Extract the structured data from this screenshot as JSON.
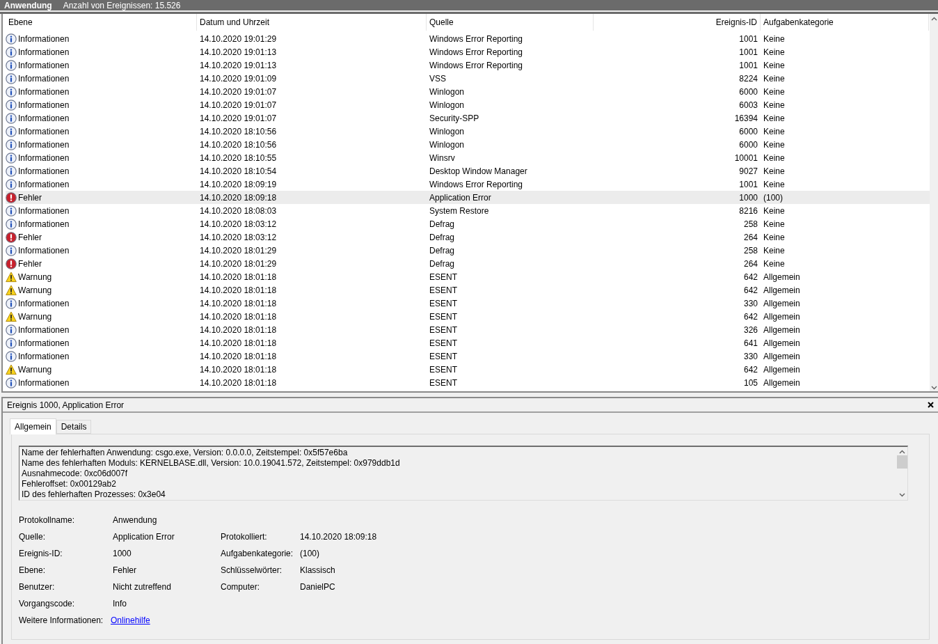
{
  "log": {
    "name": "Anwendung",
    "count": "Anzahl von Ereignissen: 15.526"
  },
  "columns": [
    {
      "label": "Ebene"
    },
    {
      "label": "Datum und Uhrzeit"
    },
    {
      "label": "Quelle"
    },
    {
      "label": "Ereignis-ID"
    },
    {
      "label": "Aufgabenkategorie"
    }
  ],
  "rows": [
    {
      "kind": "info",
      "level": "Informationen",
      "time": "14.10.2020 19:01:29",
      "source": "Windows Error Reporting",
      "id": "1001",
      "category": "Keine",
      "selected": false
    },
    {
      "kind": "info",
      "level": "Informationen",
      "time": "14.10.2020 19:01:13",
      "source": "Windows Error Reporting",
      "id": "1001",
      "category": "Keine",
      "selected": false
    },
    {
      "kind": "info",
      "level": "Informationen",
      "time": "14.10.2020 19:01:13",
      "source": "Windows Error Reporting",
      "id": "1001",
      "category": "Keine",
      "selected": false
    },
    {
      "kind": "info",
      "level": "Informationen",
      "time": "14.10.2020 19:01:09",
      "source": "VSS",
      "id": "8224",
      "category": "Keine",
      "selected": false
    },
    {
      "kind": "info",
      "level": "Informationen",
      "time": "14.10.2020 19:01:07",
      "source": "Winlogon",
      "id": "6000",
      "category": "Keine",
      "selected": false
    },
    {
      "kind": "info",
      "level": "Informationen",
      "time": "14.10.2020 19:01:07",
      "source": "Winlogon",
      "id": "6003",
      "category": "Keine",
      "selected": false
    },
    {
      "kind": "info",
      "level": "Informationen",
      "time": "14.10.2020 19:01:07",
      "source": "Security-SPP",
      "id": "16394",
      "category": "Keine",
      "selected": false
    },
    {
      "kind": "info",
      "level": "Informationen",
      "time": "14.10.2020 18:10:56",
      "source": "Winlogon",
      "id": "6000",
      "category": "Keine",
      "selected": false
    },
    {
      "kind": "info",
      "level": "Informationen",
      "time": "14.10.2020 18:10:56",
      "source": "Winlogon",
      "id": "6000",
      "category": "Keine",
      "selected": false
    },
    {
      "kind": "info",
      "level": "Informationen",
      "time": "14.10.2020 18:10:55",
      "source": "Winsrv",
      "id": "10001",
      "category": "Keine",
      "selected": false
    },
    {
      "kind": "info",
      "level": "Informationen",
      "time": "14.10.2020 18:10:54",
      "source": "Desktop Window Manager",
      "id": "9027",
      "category": "Keine",
      "selected": false
    },
    {
      "kind": "info",
      "level": "Informationen",
      "time": "14.10.2020 18:09:19",
      "source": "Windows Error Reporting",
      "id": "1001",
      "category": "Keine",
      "selected": false
    },
    {
      "kind": "error",
      "level": "Fehler",
      "time": "14.10.2020 18:09:18",
      "source": "Application Error",
      "id": "1000",
      "category": "(100)",
      "selected": true
    },
    {
      "kind": "info",
      "level": "Informationen",
      "time": "14.10.2020 18:08:03",
      "source": "System Restore",
      "id": "8216",
      "category": "Keine",
      "selected": false
    },
    {
      "kind": "info",
      "level": "Informationen",
      "time": "14.10.2020 18:03:12",
      "source": "Defrag",
      "id": "258",
      "category": "Keine",
      "selected": false
    },
    {
      "kind": "error",
      "level": "Fehler",
      "time": "14.10.2020 18:03:12",
      "source": "Defrag",
      "id": "264",
      "category": "Keine",
      "selected": false
    },
    {
      "kind": "info",
      "level": "Informationen",
      "time": "14.10.2020 18:01:29",
      "source": "Defrag",
      "id": "258",
      "category": "Keine",
      "selected": false
    },
    {
      "kind": "error",
      "level": "Fehler",
      "time": "14.10.2020 18:01:29",
      "source": "Defrag",
      "id": "264",
      "category": "Keine",
      "selected": false
    },
    {
      "kind": "warning",
      "level": "Warnung",
      "time": "14.10.2020 18:01:18",
      "source": "ESENT",
      "id": "642",
      "category": "Allgemein",
      "selected": false
    },
    {
      "kind": "warning",
      "level": "Warnung",
      "time": "14.10.2020 18:01:18",
      "source": "ESENT",
      "id": "642",
      "category": "Allgemein",
      "selected": false
    },
    {
      "kind": "info",
      "level": "Informationen",
      "time": "14.10.2020 18:01:18",
      "source": "ESENT",
      "id": "330",
      "category": "Allgemein",
      "selected": false
    },
    {
      "kind": "warning",
      "level": "Warnung",
      "time": "14.10.2020 18:01:18",
      "source": "ESENT",
      "id": "642",
      "category": "Allgemein",
      "selected": false
    },
    {
      "kind": "info",
      "level": "Informationen",
      "time": "14.10.2020 18:01:18",
      "source": "ESENT",
      "id": "326",
      "category": "Allgemein",
      "selected": false
    },
    {
      "kind": "info",
      "level": "Informationen",
      "time": "14.10.2020 18:01:18",
      "source": "ESENT",
      "id": "641",
      "category": "Allgemein",
      "selected": false
    },
    {
      "kind": "info",
      "level": "Informationen",
      "time": "14.10.2020 18:01:18",
      "source": "ESENT",
      "id": "330",
      "category": "Allgemein",
      "selected": false
    },
    {
      "kind": "warning",
      "level": "Warnung",
      "time": "14.10.2020 18:01:18",
      "source": "ESENT",
      "id": "642",
      "category": "Allgemein",
      "selected": false
    },
    {
      "kind": "info",
      "level": "Informationen",
      "time": "14.10.2020 18:01:18",
      "source": "ESENT",
      "id": "105",
      "category": "Allgemein",
      "selected": false
    }
  ],
  "detail": {
    "title": "Ereignis 1000, Application Error",
    "tabs": [
      {
        "label": "Allgemein",
        "selected": true
      },
      {
        "label": "Details",
        "selected": false
      }
    ],
    "message": [
      "Name der fehlerhaften Anwendung: csgo.exe, Version: 0.0.0.0, Zeitstempel: 0x5f57e6ba",
      "Name des fehlerhaften Moduls: KERNELBASE.dll, Version: 10.0.19041.572, Zeitstempel: 0x979ddb1d",
      "Ausnahmecode: 0xc06d007f",
      "Fehleroffset: 0x00129ab2",
      "ID des fehlerhaften Prozesses: 0x3e04"
    ],
    "properties": [
      {
        "items": [
          {
            "label": "Protokollname:",
            "value": "Anwendung",
            "kind": "text"
          }
        ]
      },
      {
        "items": [
          {
            "label": "Quelle:",
            "value": "Application Error",
            "kind": "text"
          },
          {
            "label": "Protokolliert:",
            "value": "14.10.2020 18:09:18",
            "kind": "text"
          }
        ]
      },
      {
        "items": [
          {
            "label": "Ereignis-ID:",
            "value": "1000",
            "kind": "text"
          },
          {
            "label": "Aufgabenkategorie:",
            "value": "(100)",
            "kind": "text"
          }
        ]
      },
      {
        "items": [
          {
            "label": "Ebene:",
            "value": "Fehler",
            "kind": "text"
          },
          {
            "label": "Schlüsselwörter:",
            "value": "Klassisch",
            "kind": "text"
          }
        ]
      },
      {
        "items": [
          {
            "label": "Benutzer:",
            "value": "Nicht zutreffend",
            "kind": "text"
          },
          {
            "label": "Computer:",
            "value": "DanielPC",
            "kind": "text"
          }
        ]
      },
      {
        "items": [
          {
            "label": "Vorgangscode:",
            "value": "Info",
            "kind": "text"
          }
        ]
      },
      {
        "items": [
          {
            "label": "Weitere Informationen:",
            "value": "Onlinehilfe",
            "kind": "link"
          }
        ]
      }
    ]
  }
}
